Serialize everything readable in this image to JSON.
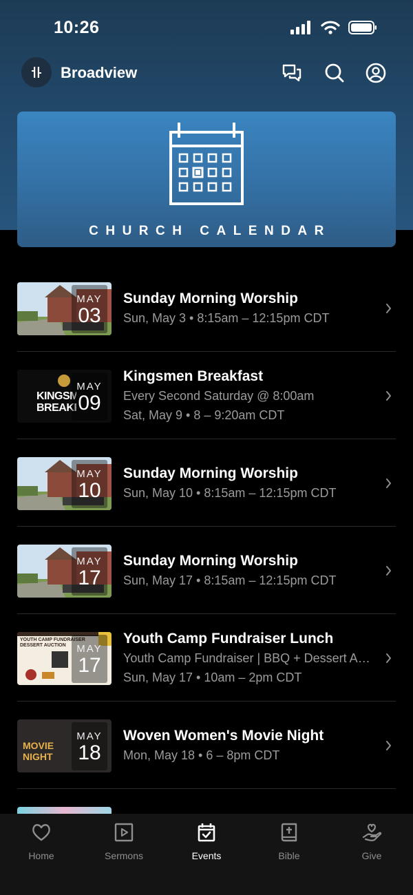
{
  "status": {
    "time": "10:26"
  },
  "header": {
    "brand": "Broadview"
  },
  "banner": {
    "title": "CHURCH CALENDAR"
  },
  "events": [
    {
      "title": "Sunday Morning Worship",
      "lines": [
        "Sun, May 3 • 8:15am – 12:15pm CDT"
      ],
      "month": "MAY",
      "day": "03",
      "thumb": "church"
    },
    {
      "title": "Kingsmen Breakfast",
      "lines": [
        "Every Second Saturday @ 8:00am",
        "Sat, May 9 • 8 – 9:20am CDT"
      ],
      "month": "MAY",
      "day": "09",
      "thumb": "kingsmen",
      "thumb_text": "KINGSMEN BREAKFAST"
    },
    {
      "title": "Sunday Morning Worship",
      "lines": [
        "Sun, May 10 • 8:15am – 12:15pm CDT"
      ],
      "month": "MAY",
      "day": "10",
      "thumb": "church"
    },
    {
      "title": "Sunday Morning Worship",
      "lines": [
        "Sun, May 17 • 8:15am – 12:15pm CDT"
      ],
      "month": "MAY",
      "day": "17",
      "thumb": "church"
    },
    {
      "title": "Youth Camp Fundraiser Lunch",
      "lines": [
        "Youth Camp Fundraiser | BBQ + Dessert Auction",
        "Sun, May 17 • 10am – 2pm CDT"
      ],
      "month": "MAY",
      "day": "17",
      "thumb": "flyer",
      "thumb_text": "YOUTH CAMP FUNDRAISER DESSERT AUCTION"
    },
    {
      "title": "Woven Women's Movie Night",
      "lines": [
        "Mon, May 18 • 6 – 8pm CDT"
      ],
      "month": "MAY",
      "day": "18",
      "thumb": "movie",
      "thumb_text": "MOVIE NIGHT"
    }
  ],
  "tabs": [
    {
      "label": "Home",
      "icon": "heart-icon",
      "active": false
    },
    {
      "label": "Sermons",
      "icon": "play-square-icon",
      "active": false
    },
    {
      "label": "Events",
      "icon": "calendar-check-icon",
      "active": true
    },
    {
      "label": "Bible",
      "icon": "bible-icon",
      "active": false
    },
    {
      "label": "Give",
      "icon": "give-hand-icon",
      "active": false
    }
  ],
  "colors": {
    "header_bg": "#224a6c",
    "banner_bg": "#3470a4",
    "background": "#000000",
    "tabbar_bg": "#141414",
    "muted_text": "#9b9b9b"
  }
}
